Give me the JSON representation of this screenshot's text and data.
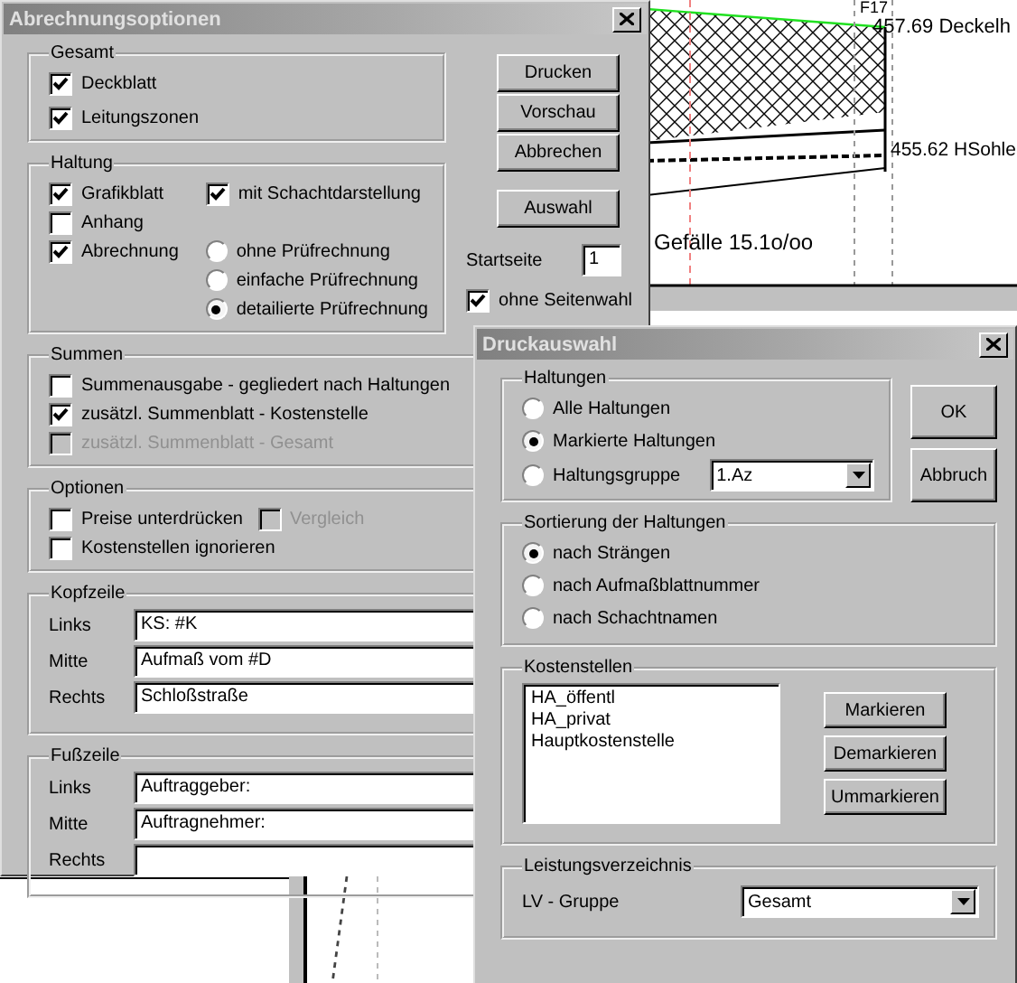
{
  "drawing": {
    "labels": [
      {
        "text": "F17"
      },
      {
        "text": "457.69 Deckelh"
      },
      {
        "text": "455.62 HSohle"
      },
      {
        "text": "Gefälle 15.1o/oo"
      }
    ]
  },
  "options_dialog": {
    "title": "Abrechnungsoptionen",
    "gesamt": {
      "title": "Gesamt",
      "checkboxes": [
        {
          "label": "Deckblatt",
          "checked": true,
          "disabled": false
        },
        {
          "label": "Leitungszonen",
          "checked": true,
          "disabled": false
        }
      ]
    },
    "haltung": {
      "title": "Haltung",
      "checkboxes": [
        {
          "label": "Grafikblatt",
          "checked": true,
          "disabled": false
        },
        {
          "label": "Anhang",
          "checked": false,
          "disabled": false
        },
        {
          "label": "Abrechnung",
          "checked": true,
          "disabled": false
        }
      ],
      "schacht": {
        "label": "mit Schachtdarstellung",
        "checked": true,
        "disabled": false
      },
      "radios": [
        {
          "label": "ohne Prüfrechnung",
          "selected": false
        },
        {
          "label": "einfache Prüfrechnung",
          "selected": false
        },
        {
          "label": "detailierte Prüfrechnung",
          "selected": true
        }
      ]
    },
    "summen": {
      "title": "Summen",
      "checkboxes": [
        {
          "label": "Summenausgabe - gegliedert nach Haltungen",
          "checked": false,
          "disabled": false
        },
        {
          "label": "zusätzl. Summenblatt - Kostenstelle",
          "checked": true,
          "disabled": false
        },
        {
          "label": "zusätzl. Summenblatt - Gesamt",
          "checked": false,
          "disabled": true
        }
      ]
    },
    "optionen": {
      "title": "Optionen",
      "rows": [
        [
          {
            "label": "Preise unterdrücken",
            "checked": false,
            "disabled": false
          },
          {
            "label": "Vergleich",
            "checked": false,
            "disabled": true
          }
        ],
        [
          {
            "label": "Kostenstellen ignorieren",
            "checked": false,
            "disabled": false
          }
        ]
      ]
    },
    "kopfzeile": {
      "title": "Kopfzeile",
      "fields": [
        {
          "label": "Links",
          "value": "KS: #K"
        },
        {
          "label": "Mitte",
          "value": "Aufmaß vom #D"
        },
        {
          "label": "Rechts",
          "value": "Schloßstraße"
        }
      ]
    },
    "fusszeile": {
      "title": "Fußzeile",
      "fields": [
        {
          "label": "Links",
          "value": "Auftraggeber:"
        },
        {
          "label": "Mitte",
          "value": "Auftragnehmer:"
        },
        {
          "label": "Rechts"
        }
      ]
    },
    "buttons": [
      "Drucken",
      "Vorschau",
      "Abbrechen",
      "Auswahl"
    ],
    "startseite": {
      "label": "Startseite",
      "value": "1"
    },
    "ohne_seitenwahl": {
      "label": "ohne Seitenwahl",
      "checked": true,
      "disabled": false
    }
  },
  "select_dialog": {
    "title": "Druckauswahl",
    "haltungen": {
      "title": "Haltungen",
      "radios": [
        {
          "label": "Alle Haltungen",
          "selected": false
        },
        {
          "label": "Markierte Haltungen",
          "selected": true
        },
        {
          "label": "Haltungsgruppe",
          "selected": false
        }
      ],
      "group_select": {
        "value": "1.Az"
      }
    },
    "buttons": [
      "OK",
      "Abbruch"
    ],
    "sortierung": {
      "title": "Sortierung der Haltungen",
      "radios": [
        {
          "label": "nach Strängen",
          "selected": true
        },
        {
          "label": "nach Aufmaßblattnummer",
          "selected": false
        },
        {
          "label": "nach Schachtnamen",
          "selected": false
        }
      ]
    },
    "kostenstellen": {
      "title": "Kostenstellen",
      "items": [
        {
          "label": "HA_öffentl",
          "selected": false
        },
        {
          "label": "HA_privat",
          "selected": false
        },
        {
          "label": "Hauptkostenstelle",
          "selected": false
        }
      ],
      "buttons": [
        "Markieren",
        "Demarkieren",
        "Ummarkieren"
      ]
    },
    "lv": {
      "title": "Leistungsverzeichnis",
      "label": "LV - Gruppe",
      "value": "Gesamt"
    }
  }
}
